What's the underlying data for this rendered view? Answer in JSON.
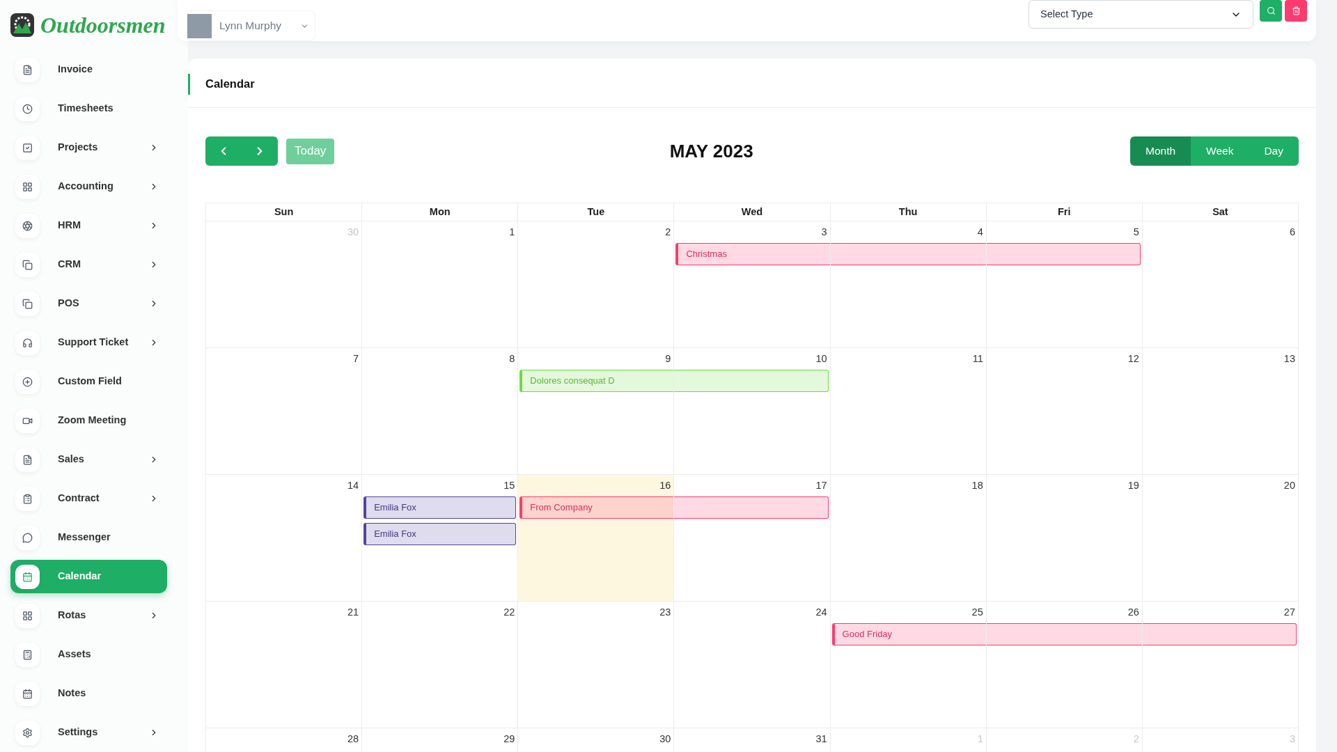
{
  "brand": {
    "name": "Outdoorsmen"
  },
  "user": {
    "name": "Lynn Murphy"
  },
  "filter": {
    "placeholder": "Select Type"
  },
  "sidebar": {
    "items": [
      {
        "label": "Invoice",
        "expandable": false,
        "selected": false
      },
      {
        "label": "Timesheets",
        "expandable": false,
        "selected": false
      },
      {
        "label": "Projects",
        "expandable": true,
        "selected": false
      },
      {
        "label": "Accounting",
        "expandable": true,
        "selected": false
      },
      {
        "label": "HRM",
        "expandable": true,
        "selected": false
      },
      {
        "label": "CRM",
        "expandable": true,
        "selected": false
      },
      {
        "label": "POS",
        "expandable": true,
        "selected": false
      },
      {
        "label": "Support Ticket",
        "expandable": true,
        "selected": false
      },
      {
        "label": "Custom Field",
        "expandable": false,
        "selected": false
      },
      {
        "label": "Zoom Meeting",
        "expandable": false,
        "selected": false
      },
      {
        "label": "Sales",
        "expandable": true,
        "selected": false
      },
      {
        "label": "Contract",
        "expandable": true,
        "selected": false
      },
      {
        "label": "Messenger",
        "expandable": false,
        "selected": false
      },
      {
        "label": "Calendar",
        "expandable": false,
        "selected": true
      },
      {
        "label": "Rotas",
        "expandable": true,
        "selected": false
      },
      {
        "label": "Assets",
        "expandable": false,
        "selected": false
      },
      {
        "label": "Notes",
        "expandable": false,
        "selected": false
      },
      {
        "label": "Settings",
        "expandable": true,
        "selected": false
      }
    ]
  },
  "page": {
    "title": "Calendar"
  },
  "calendar": {
    "title": "MAY 2023",
    "today_button": "Today",
    "views": [
      {
        "label": "Month",
        "selected": true
      },
      {
        "label": "Week",
        "selected": false
      },
      {
        "label": "Day",
        "selected": false
      }
    ],
    "weekdays": [
      "Sun",
      "Mon",
      "Tue",
      "Wed",
      "Thu",
      "Fri",
      "Sat"
    ],
    "weeks": [
      {
        "days": [
          {
            "label": "30",
            "other_month": true,
            "today": false
          },
          {
            "label": "1",
            "other_month": false,
            "today": false
          },
          {
            "label": "2",
            "other_month": false,
            "today": false
          },
          {
            "label": "3",
            "other_month": false,
            "today": false,
            "events": [
              {
                "title": "Christmas",
                "color": "#ff3a6e",
                "continued": false,
                "continues": true
              }
            ]
          },
          {
            "label": "4",
            "other_month": false,
            "today": false,
            "events": [
              {
                "color": "#ff3a6e",
                "continued": true,
                "continues": true
              }
            ]
          },
          {
            "label": "5",
            "other_month": false,
            "today": false,
            "events": [
              {
                "color": "#ff3a6e",
                "continued": true,
                "continues": false
              }
            ]
          },
          {
            "label": "6",
            "other_month": false,
            "today": false
          }
        ]
      },
      {
        "days": [
          {
            "label": "7",
            "other_month": false,
            "today": false
          },
          {
            "label": "8",
            "other_month": false,
            "today": false
          },
          {
            "label": "9",
            "other_month": false,
            "today": false,
            "events": [
              {
                "title": "Dolores consequat D",
                "color": "#6fd943",
                "continued": false,
                "continues": true
              }
            ]
          },
          {
            "label": "10",
            "other_month": false,
            "today": false,
            "events": [
              {
                "color": "#6fd943",
                "continued": true,
                "continues": false
              }
            ]
          },
          {
            "label": "11",
            "other_month": false,
            "today": false
          },
          {
            "label": "12",
            "other_month": false,
            "today": false
          },
          {
            "label": "13",
            "other_month": false,
            "today": false
          }
        ]
      },
      {
        "days": [
          {
            "label": "14",
            "other_month": false,
            "today": false
          },
          {
            "label": "15",
            "other_month": false,
            "today": false,
            "events": [
              {
                "title": "Emilia Fox",
                "color": "#51459d",
                "continued": false,
                "continues": false
              },
              {
                "title": "Emilia Fox",
                "color": "#51459d",
                "continued": false,
                "continues": false
              }
            ]
          },
          {
            "label": "16",
            "other_month": false,
            "today": true,
            "events": [
              {
                "title": "From Company",
                "color": "#ff3a6e",
                "continued": false,
                "continues": true
              }
            ]
          },
          {
            "label": "17",
            "other_month": false,
            "today": false,
            "events": [
              {
                "color": "#ff3a6e",
                "continued": true,
                "continues": false
              }
            ]
          },
          {
            "label": "18",
            "other_month": false,
            "today": false
          },
          {
            "label": "19",
            "other_month": false,
            "today": false
          },
          {
            "label": "20",
            "other_month": false,
            "today": false
          }
        ]
      },
      {
        "days": [
          {
            "label": "21",
            "other_month": false,
            "today": false
          },
          {
            "label": "22",
            "other_month": false,
            "today": false
          },
          {
            "label": "23",
            "other_month": false,
            "today": false
          },
          {
            "label": "24",
            "other_month": false,
            "today": false
          },
          {
            "label": "25",
            "other_month": false,
            "today": false,
            "events": [
              {
                "title": "Good Friday",
                "color": "#ff3a6e",
                "continued": false,
                "continues": true
              }
            ]
          },
          {
            "label": "26",
            "other_month": false,
            "today": false,
            "events": [
              {
                "color": "#ff3a6e",
                "continued": true,
                "continues": true
              }
            ]
          },
          {
            "label": "27",
            "other_month": false,
            "today": false,
            "events": [
              {
                "color": "#ff3a6e",
                "continued": true,
                "continues": false
              }
            ]
          }
        ]
      },
      {
        "days": [
          {
            "label": "28",
            "other_month": false,
            "today": false
          },
          {
            "label": "29",
            "other_month": false,
            "today": false
          },
          {
            "label": "30",
            "other_month": false,
            "today": false
          },
          {
            "label": "31",
            "other_month": false,
            "today": false
          },
          {
            "label": "1",
            "other_month": true,
            "today": false
          },
          {
            "label": "2",
            "other_month": true,
            "today": false
          },
          {
            "label": "3",
            "other_month": true,
            "today": false
          }
        ]
      }
    ]
  }
}
